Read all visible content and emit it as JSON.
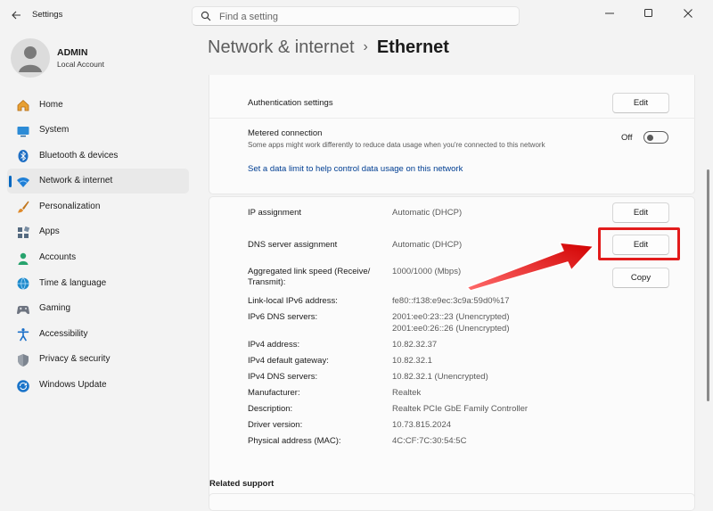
{
  "window": {
    "title": "Settings"
  },
  "search": {
    "placeholder": "Find a setting"
  },
  "profile": {
    "name": "ADMIN",
    "account_type": "Local Account"
  },
  "nav": {
    "items": [
      {
        "label": "Home",
        "icon": "home-icon"
      },
      {
        "label": "System",
        "icon": "system-icon"
      },
      {
        "label": "Bluetooth & devices",
        "icon": "bluetooth-icon"
      },
      {
        "label": "Network & internet",
        "icon": "network-icon",
        "active": true
      },
      {
        "label": "Personalization",
        "icon": "brush-icon"
      },
      {
        "label": "Apps",
        "icon": "apps-icon"
      },
      {
        "label": "Accounts",
        "icon": "accounts-icon"
      },
      {
        "label": "Time & language",
        "icon": "time-language-icon"
      },
      {
        "label": "Gaming",
        "icon": "gaming-icon"
      },
      {
        "label": "Accessibility",
        "icon": "accessibility-icon"
      },
      {
        "label": "Privacy & security",
        "icon": "shield-icon"
      },
      {
        "label": "Windows Update",
        "icon": "windows-update-icon"
      }
    ]
  },
  "breadcrumb": {
    "parent": "Network & internet",
    "separator": "›",
    "current": "Ethernet"
  },
  "settings": {
    "auth": {
      "label": "Authentication settings",
      "button": "Edit"
    },
    "metered": {
      "label": "Metered connection",
      "description": "Some apps might work differently to reduce data usage when you're connected to this network",
      "toggle_state": "Off",
      "link": "Set a data limit to help control data usage on this network"
    },
    "ip": {
      "label": "IP assignment",
      "value": "Automatic (DHCP)",
      "button": "Edit"
    },
    "dns": {
      "label": "DNS server assignment",
      "value": "Automatic (DHCP)",
      "button": "Edit"
    },
    "copy_button": "Copy",
    "properties": {
      "link_speed_label_1": "Aggregated link speed (Receive/",
      "link_speed_label_2": "Transmit):",
      "link_speed_value": "1000/1000 (Mbps)",
      "ipv6_local_label": "Link-local IPv6 address:",
      "ipv6_local_value": "fe80::f138:e9ec:3c9a:59d0%17",
      "ipv6_dns_label": "IPv6 DNS servers:",
      "ipv6_dns_value_1": "2001:ee0:23::23 (Unencrypted)",
      "ipv6_dns_value_2": "2001:ee0:26::26 (Unencrypted)",
      "ipv4_label": "IPv4 address:",
      "ipv4_value": "10.82.32.37",
      "gateway_label": "IPv4 default gateway:",
      "gateway_value": "10.82.32.1",
      "ipv4_dns_label": "IPv4 DNS servers:",
      "ipv4_dns_value": "10.82.32.1 (Unencrypted)",
      "manufacturer_label": "Manufacturer:",
      "manufacturer_value": "Realtek",
      "description_label": "Description:",
      "description_value": "Realtek PCIe GbE Family Controller",
      "driver_label": "Driver version:",
      "driver_value": "10.73.815.2024",
      "mac_label": "Physical address (MAC):",
      "mac_value": "4C:CF:7C:30:54:5C"
    }
  },
  "related": {
    "label": "Related support"
  },
  "colors": {
    "accent": "#0067c0",
    "annotation": "#e21b1b",
    "link": "#003e92"
  }
}
